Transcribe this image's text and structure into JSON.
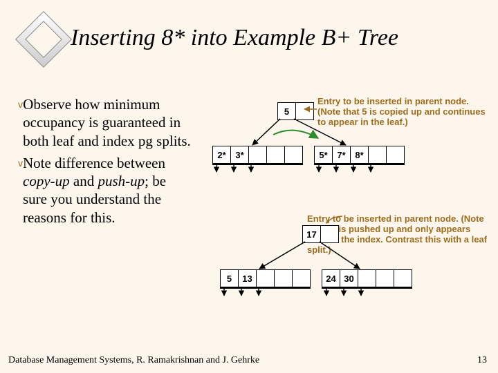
{
  "title": "Inserting 8* into Example B+ Tree",
  "bullets": [
    {
      "plain_a": "Observe how minimum occupancy is guaranteed in both leaf and index pg splits."
    },
    {
      "plain_a": "Note difference between ",
      "em_a": "copy-up",
      "plain_b": " and ",
      "em_b": "push-up",
      "plain_c": "; be sure you understand the reasons for this."
    }
  ],
  "notes": {
    "n1": "Entry to be inserted in parent node. (Note that 5 is copied up and continues to appear in the leaf.)",
    "n2": "Entry to be inserted in parent node. (Note that 17 is pushed up and only appears once in the index. Contrast this with a leaf split.)"
  },
  "diagram": {
    "upper_parent": [
      "5"
    ],
    "upper_leaf_left": [
      "2*",
      "3*"
    ],
    "upper_leaf_right": [
      "5*",
      "7*",
      "8*"
    ],
    "lower_parent": [
      "17"
    ],
    "lower_leaf_left": [
      "5",
      "13"
    ],
    "lower_leaf_right": [
      "24",
      "30"
    ]
  },
  "footer": {
    "left": "Database Management Systems, R. Ramakrishnan and J. Gehrke",
    "right": "13"
  },
  "colors": {
    "accent": "#9c6d1e",
    "arrow_green": "#2e8b2e"
  }
}
